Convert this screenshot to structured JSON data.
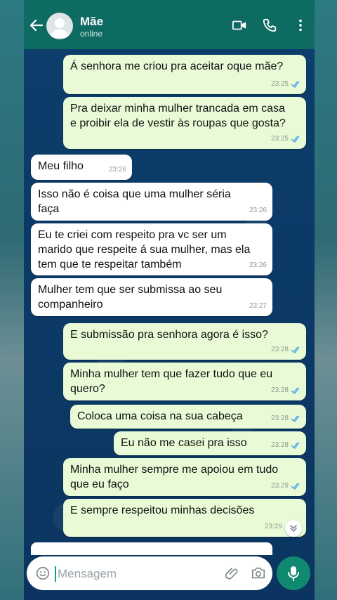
{
  "header": {
    "contact_name": "Mãe",
    "status": "online"
  },
  "messages": [
    {
      "dir": "out",
      "text": "Á senhora me criou pra aceitar oque mãe?",
      "time": "23:25"
    },
    {
      "dir": "out",
      "text": "Pra deixar minha mulher trancada em casa\ne proibir ela de vestir às roupas que gosta?",
      "time": "23:25"
    },
    {
      "dir": "in",
      "text": "Meu filho",
      "time": "23:26"
    },
    {
      "dir": "in",
      "text": "Isso não é coisa que uma mulher séria\nfaça",
      "time": "23:26"
    },
    {
      "dir": "in",
      "text": "Eu te criei com respeito pra vc ser um\nmarido que respeite á sua mulher, mas ela\ntem que te respeitar também",
      "time": "23:26"
    },
    {
      "dir": "in",
      "text": "Mulher tem que ser submissa ao seu\ncompanheiro",
      "time": "23:27"
    },
    {
      "dir": "out",
      "text": "E submissão pra senhora agora é isso?",
      "time": "23:28"
    },
    {
      "dir": "out",
      "text": "Minha mulher tem que fazer tudo que eu\nquero?",
      "time": "23:28"
    },
    {
      "dir": "out",
      "text": "Coloca uma coisa na sua cabeça",
      "time": "23:28"
    },
    {
      "dir": "out",
      "text": "Eu não me casei pra isso",
      "time": "23:28"
    },
    {
      "dir": "out",
      "text": "Minha mulher sempre me apoiou em tudo\nque eu faço",
      "time": "23:29"
    },
    {
      "dir": "out",
      "text": "E sempre respeitou minhas decisões",
      "time": "23:29"
    }
  ],
  "composer": {
    "placeholder": "Mensagem"
  },
  "colors": {
    "header": "#0e6b61",
    "outgoing_bubble": "#e8fbd6",
    "incoming_bubble": "#ffffff",
    "read_ticks": "#53a7e8",
    "mic_button": "#0f8a71"
  }
}
